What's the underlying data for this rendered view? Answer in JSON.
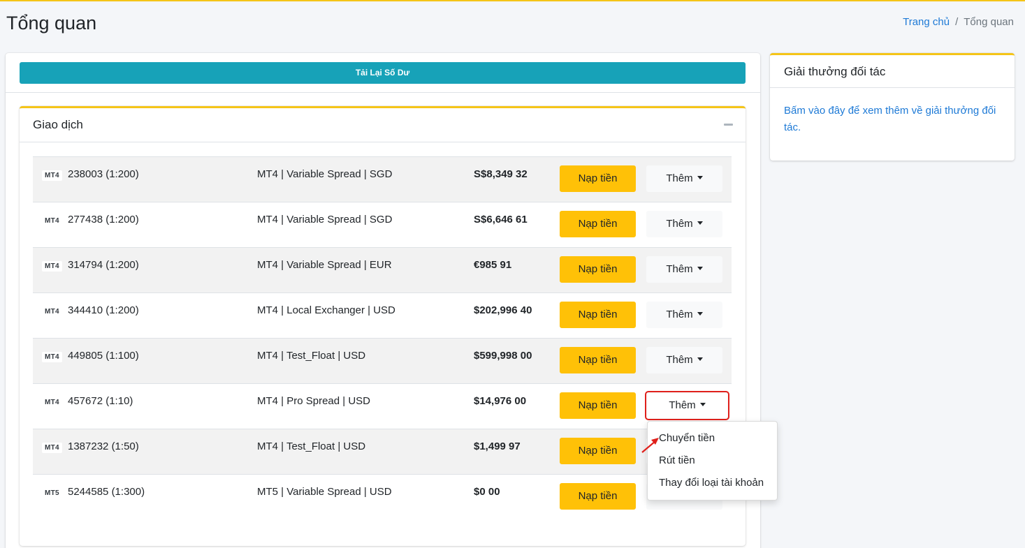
{
  "page": {
    "title": "Tổng quan"
  },
  "breadcrumb": {
    "home": "Trang chủ",
    "separator": "/",
    "current": "Tổng quan"
  },
  "reload_button": "Tải Lại Số Dư",
  "trade_card": {
    "title": "Giao dịch",
    "deposit_label": "Nạp tiền",
    "more_label": "Thêm",
    "accounts": [
      {
        "platform": "MT4",
        "account": "238003 (1:200)",
        "type": "MT4 | Variable Spread | SGD",
        "balance": "S$8,349 32"
      },
      {
        "platform": "MT4",
        "account": "277438 (1:200)",
        "type": "MT4 | Variable Spread | SGD",
        "balance": "S$6,646 61"
      },
      {
        "platform": "MT4",
        "account": "314794 (1:200)",
        "type": "MT4 | Variable Spread | EUR",
        "balance": "€985 91"
      },
      {
        "platform": "MT4",
        "account": "344410 (1:200)",
        "type": "MT4 | Local Exchanger | USD",
        "balance": "$202,996 40"
      },
      {
        "platform": "MT4",
        "account": "449805 (1:100)",
        "type": "MT4 | Test_Float | USD",
        "balance": "$599,998 00"
      },
      {
        "platform": "MT4",
        "account": "457672 (1:10)",
        "type": "MT4 | Pro Spread | USD",
        "balance": "$14,976 00"
      },
      {
        "platform": "MT4",
        "account": "1387232 (1:50)",
        "type": "MT4 | Test_Float | USD",
        "balance": "$1,499 97"
      },
      {
        "platform": "MT5",
        "account": "5244585 (1:300)",
        "type": "MT5 | Variable Spread | USD",
        "balance": "$0 00"
      }
    ]
  },
  "dropdown": {
    "items": [
      "Chuyển tiền",
      "Rút tiền",
      "Thay đổi loại tài khoản"
    ]
  },
  "partner_card": {
    "title": "Giải thưởng đối tác",
    "link_text": "Bấm vào đây để xem thêm về giải thưởng đối tác."
  },
  "colors": {
    "accent": "#f5c518",
    "reload": "#17a2b8",
    "deposit": "#ffc107",
    "link": "#1e7ad6",
    "highlight": "#e0201b"
  }
}
